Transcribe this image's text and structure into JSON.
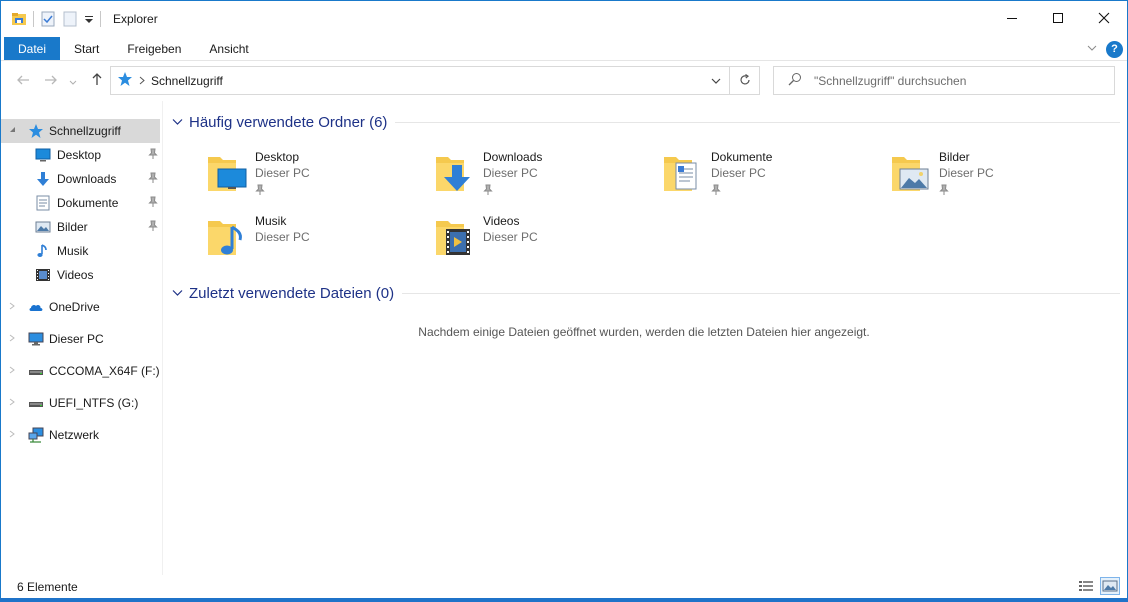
{
  "window": {
    "title": "Explorer",
    "controls": [
      "minimize-icon",
      "maximize-icon",
      "close-icon"
    ]
  },
  "ribbon": {
    "tabs": [
      {
        "label": "Datei"
      },
      {
        "label": "Start"
      },
      {
        "label": "Freigeben"
      },
      {
        "label": "Ansicht"
      }
    ]
  },
  "navigation": {
    "breadcrumb": "Schnellzugriff",
    "search_placeholder": "\"Schnellzugriff\" durchsuchen"
  },
  "sidebar": {
    "items": [
      {
        "label": "Schnellzugriff",
        "icon": "star-icon",
        "selected": true
      },
      {
        "label": "Desktop",
        "icon": "desktop-icon",
        "pinned": true
      },
      {
        "label": "Downloads",
        "icon": "download-icon",
        "pinned": true
      },
      {
        "label": "Dokumente",
        "icon": "document-icon",
        "pinned": true
      },
      {
        "label": "Bilder",
        "icon": "picture-icon",
        "pinned": true
      },
      {
        "label": "Musik",
        "icon": "music-icon"
      },
      {
        "label": "Videos",
        "icon": "video-icon"
      },
      {
        "label": "OneDrive",
        "icon": "cloud-icon"
      },
      {
        "label": "Dieser PC",
        "icon": "computer-icon"
      },
      {
        "label": "CCCOMA_X64F (F:)",
        "icon": "drive-icon"
      },
      {
        "label": "UEFI_NTFS (G:)",
        "icon": "drive-icon"
      },
      {
        "label": "Netzwerk",
        "icon": "network-icon"
      }
    ]
  },
  "content": {
    "frequent": {
      "title": "Häufig verwendete Ordner (6)",
      "folders": [
        {
          "name": "Desktop",
          "location": "Dieser PC",
          "pinned": true,
          "icon": "folder-desktop-icon"
        },
        {
          "name": "Downloads",
          "location": "Dieser PC",
          "pinned": true,
          "icon": "folder-downloads-icon"
        },
        {
          "name": "Dokumente",
          "location": "Dieser PC",
          "pinned": true,
          "icon": "folder-documents-icon"
        },
        {
          "name": "Bilder",
          "location": "Dieser PC",
          "pinned": true,
          "icon": "folder-pictures-icon"
        },
        {
          "name": "Musik",
          "location": "Dieser PC",
          "pinned": false,
          "icon": "folder-music-icon"
        },
        {
          "name": "Videos",
          "location": "Dieser PC",
          "pinned": false,
          "icon": "folder-videos-icon"
        }
      ]
    },
    "recent": {
      "title": "Zuletzt verwendete Dateien (0)",
      "empty_message": "Nachdem einige Dateien geöffnet wurden, werden die letzten Dateien hier angezeigt."
    }
  },
  "status": {
    "count": "6 Elemente"
  },
  "colors": {
    "accent": "#1979ca",
    "group_title": "#1e3287",
    "selection": "#d9d9d9",
    "folder": "#f5c94e"
  }
}
